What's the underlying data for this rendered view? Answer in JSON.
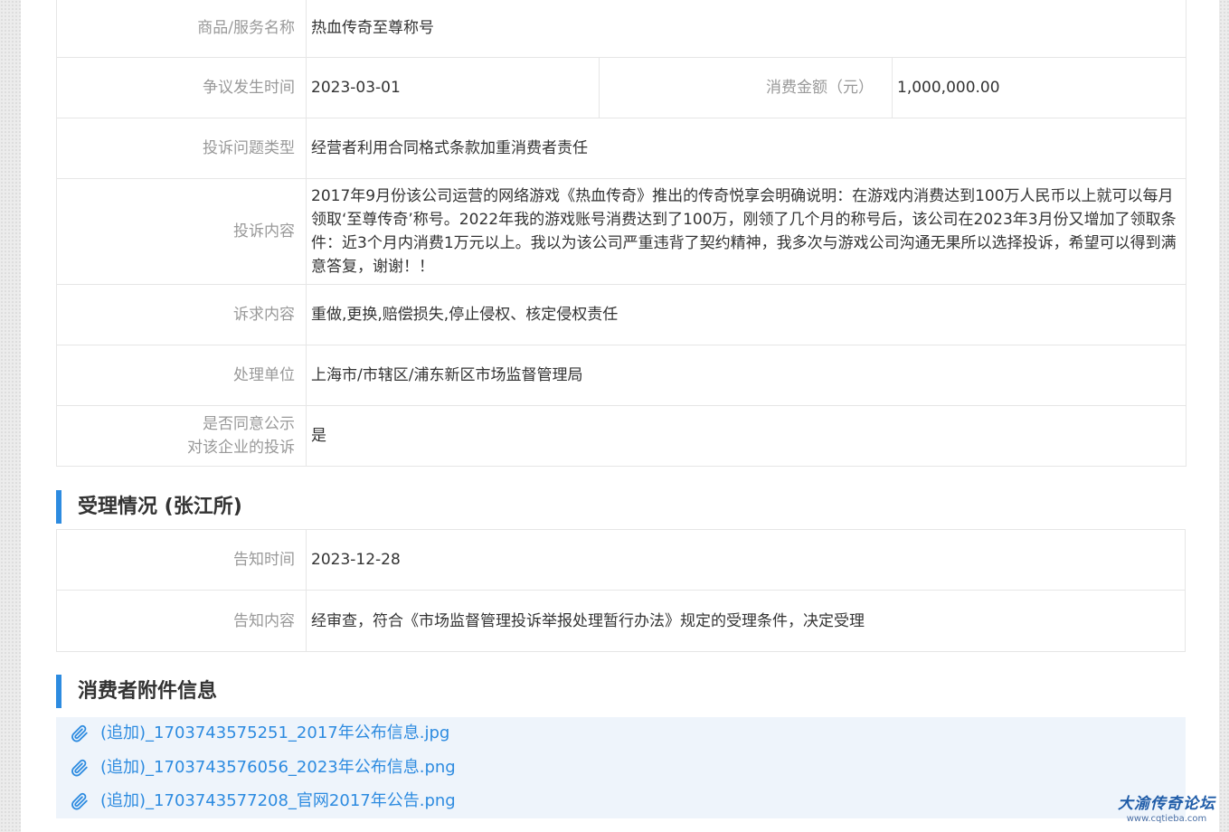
{
  "details": {
    "product_label": "商品/服务名称",
    "product_value": "热血传奇至尊称号",
    "dispute_time_label": "争议发生时间",
    "dispute_time_value": "2023-03-01",
    "amount_label": "消费金额（元）",
    "amount_value": "1,000,000.00",
    "issue_type_label": "投诉问题类型",
    "issue_type_value": "经营者利用合同格式条款加重消费者责任",
    "content_label": "投诉内容",
    "content_value": "2017年9月份该公司运营的网络游戏《热血传奇》推出的传奇悦享会明确说明：在游戏内消费达到100万人民币以上就可以每月领取‘至尊传奇’称号。2022年我的游戏账号消费达到了100万，刚领了几个月的称号后，该公司在2023年3月份又增加了领取条件：近3个月内消费1万元以上。我以为该公司严重违背了契约精神，我多次与游戏公司沟通无果所以选择投诉，希望可以得到满意答复，谢谢！！",
    "demand_label": "诉求内容",
    "demand_value": "重做,更换,赔偿损失,停止侵权、核定侵权责任",
    "handler_label": "处理单位",
    "handler_value": "上海市/市辖区/浦东新区市场监督管理局",
    "public_label_1": "是否同意公示",
    "public_label_2": "对该企业的投诉",
    "public_value": "是"
  },
  "acceptance": {
    "title": "受理情况 (张江所)",
    "notice_time_label": "告知时间",
    "notice_time_value": "2023-12-28",
    "notice_content_label": "告知内容",
    "notice_content_value": "经审查，符合《市场监督管理投诉举报处理暂行办法》规定的受理条件，决定受理"
  },
  "attachments": {
    "title": "消费者附件信息",
    "items": [
      "(追加)_1703743575251_2017年公布信息.jpg",
      "(追加)_1703743576056_2023年公布信息.png",
      "(追加)_1703743577208_官网2017年公告.png"
    ],
    "icon": "paperclip-icon",
    "link_color": "#2d8be0"
  },
  "watermark": {
    "main": "大渝传奇论坛",
    "sub": "www.cqtieba.com"
  },
  "colors": {
    "accent": "#2d8be0",
    "label": "#999999",
    "text": "#333333"
  }
}
